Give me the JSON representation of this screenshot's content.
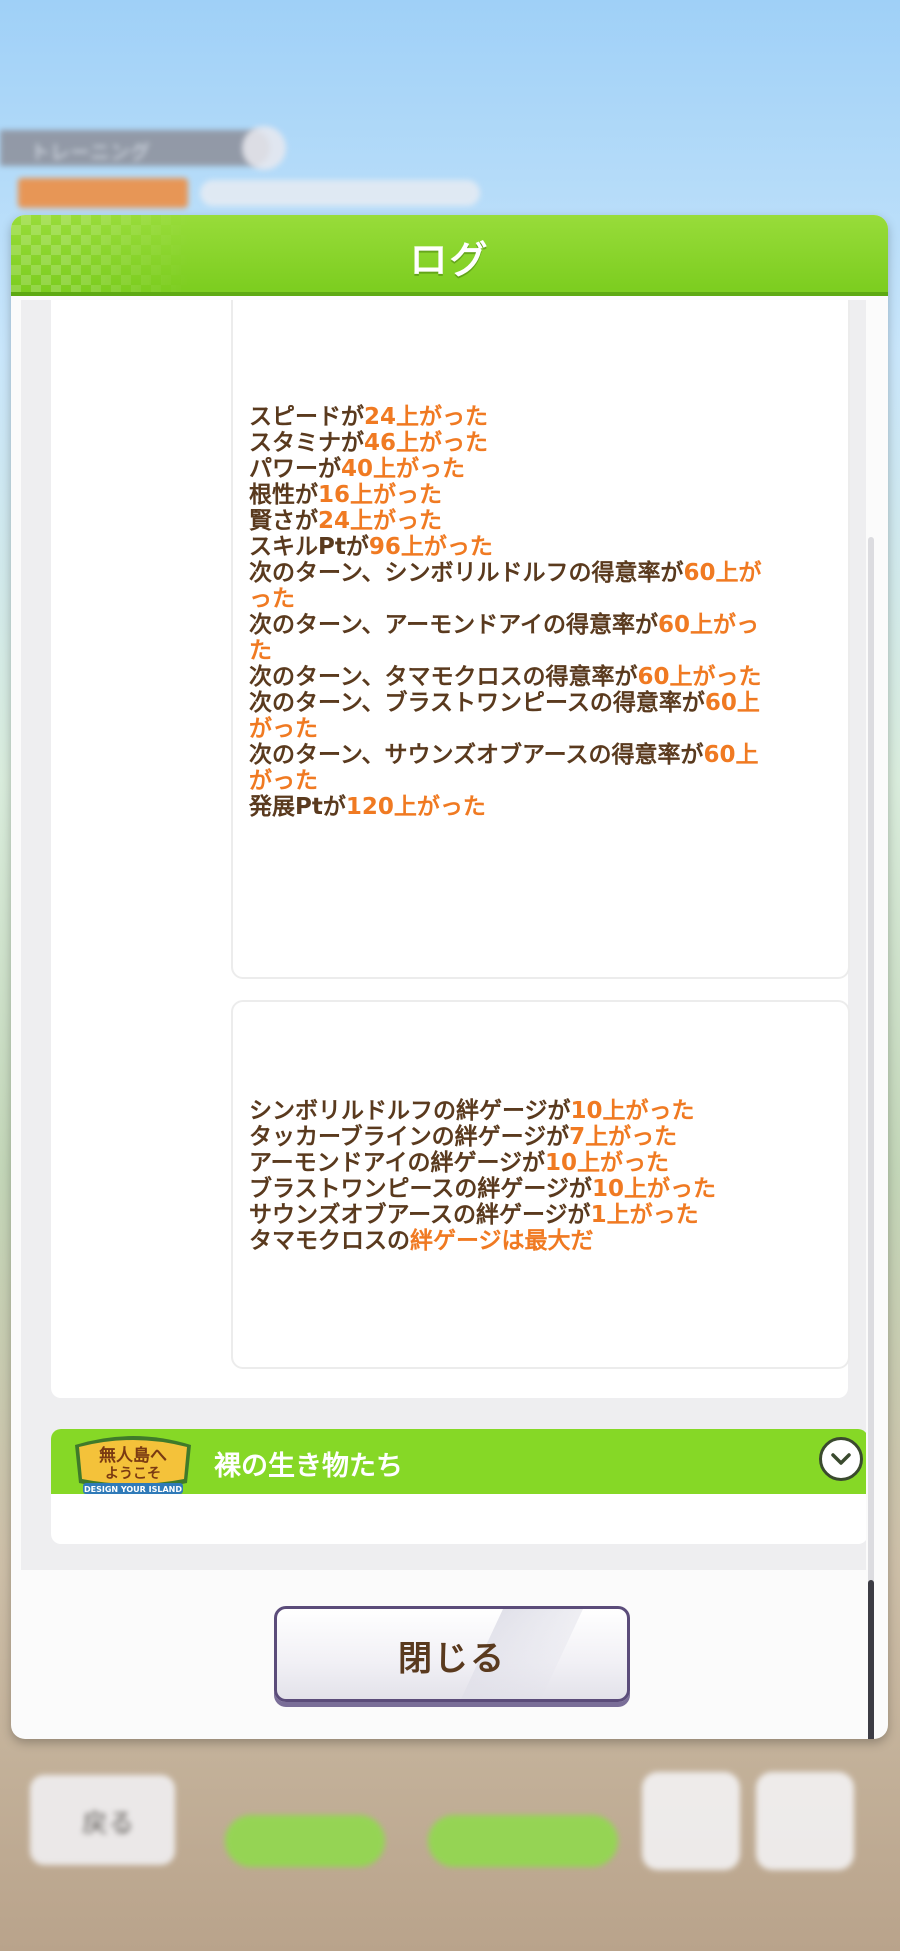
{
  "background": {
    "tab_label": "トレーニング",
    "back_label": "戻る"
  },
  "modal": {
    "title": "ログ",
    "card1_lines": [
      [
        {
          "t": "スピードが",
          "h": false
        },
        {
          "t": "24上がった",
          "h": true
        }
      ],
      [
        {
          "t": "スタミナが",
          "h": false
        },
        {
          "t": "46上がった",
          "h": true
        }
      ],
      [
        {
          "t": "パワーが",
          "h": false
        },
        {
          "t": "40上がった",
          "h": true
        }
      ],
      [
        {
          "t": "根性が",
          "h": false
        },
        {
          "t": "16上がった",
          "h": true
        }
      ],
      [
        {
          "t": "賢さが",
          "h": false
        },
        {
          "t": "24上がった",
          "h": true
        }
      ],
      [
        {
          "t": "スキルPtが",
          "h": false
        },
        {
          "t": "96上がった",
          "h": true
        }
      ],
      [
        {
          "t": "次のターン、シンボリルドルフの得意率が",
          "h": false
        },
        {
          "t": "60上がった",
          "h": true
        }
      ],
      [
        {
          "t": "次のターン、アーモンドアイの得意率が",
          "h": false
        },
        {
          "t": "60上がった",
          "h": true
        }
      ],
      [
        {
          "t": "次のターン、タマモクロスの得意率が",
          "h": false
        },
        {
          "t": "60上がった",
          "h": true
        }
      ],
      [
        {
          "t": "次のターン、ブラストワンピースの得意率が",
          "h": false
        },
        {
          "t": "60上がった",
          "h": true
        }
      ],
      [
        {
          "t": "次のターン、サウンズオブアースの得意率が",
          "h": false
        },
        {
          "t": "60上がった",
          "h": true
        }
      ],
      [
        {
          "t": "発展Ptが",
          "h": false
        },
        {
          "t": "120上がった",
          "h": true
        }
      ]
    ],
    "card2_lines": [
      [
        {
          "t": "シンボリルドルフの絆ゲージが",
          "h": false
        },
        {
          "t": "10上がった",
          "h": true
        }
      ],
      [
        {
          "t": "タッカーブラインの絆ゲージが",
          "h": false
        },
        {
          "t": "7上がった",
          "h": true
        }
      ],
      [
        {
          "t": "アーモンドアイの絆ゲージが",
          "h": false
        },
        {
          "t": "10上がった",
          "h": true
        }
      ],
      [
        {
          "t": "ブラストワンピースの絆ゲージが",
          "h": false
        },
        {
          "t": "10上がった",
          "h": true
        }
      ],
      [
        {
          "t": "サウンズオブアースの絆ゲージが",
          "h": false
        },
        {
          "t": "1上がった",
          "h": true
        }
      ],
      [
        {
          "t": "タマモクロスの",
          "h": false
        },
        {
          "t": "絆ゲージは最大だ",
          "h": true
        }
      ]
    ],
    "story": {
      "logo_line1": "無人島へ",
      "logo_line2": "ようこそ",
      "logo_sub": "DESIGN YOUR ISLAND",
      "title": "裸の生き物たち"
    },
    "close_label": "閉じる"
  },
  "colors": {
    "header_green": "#7ccd1f",
    "text_brown": "#5a3a1e",
    "highlight_orange": "#f07a22"
  }
}
